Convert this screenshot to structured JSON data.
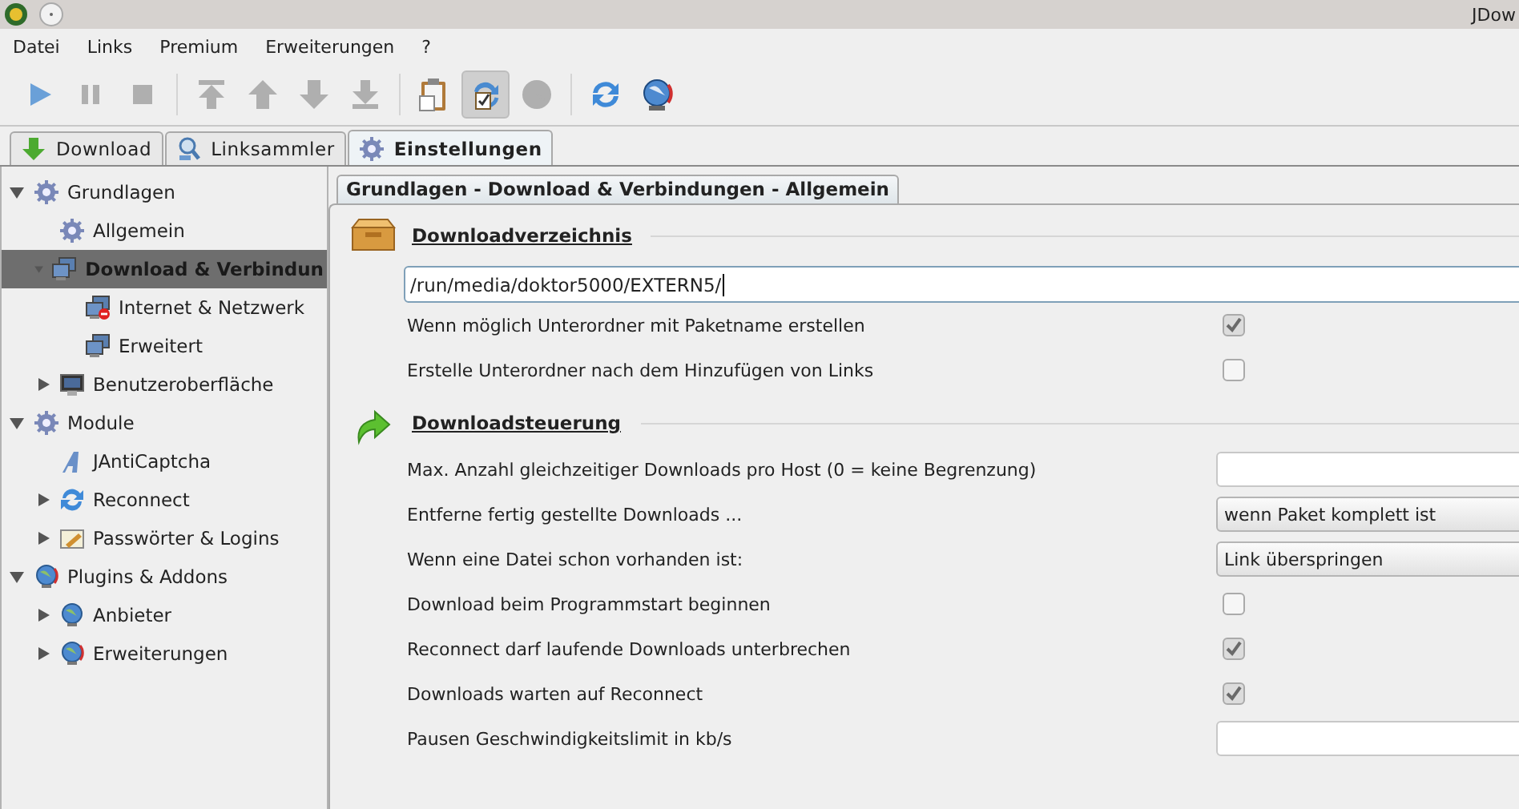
{
  "window": {
    "title": "JDow"
  },
  "menu": [
    "Datei",
    "Links",
    "Premium",
    "Erweiterungen",
    "?"
  ],
  "toolbar": [
    [
      {
        "disabled": false,
        "on": false
      },
      {
        "disabled": true,
        "on": false
      },
      {
        "disabled": true,
        "on": false
      }
    ],
    [
      {
        "disabled": true,
        "on": false
      },
      {
        "disabled": true,
        "on": false
      },
      {
        "disabled": true,
        "on": false
      },
      {
        "disabled": true,
        "on": false
      }
    ],
    [
      {
        "disabled": false,
        "on": false
      },
      {
        "disabled": false,
        "on": true
      },
      {
        "disabled": true,
        "on": false
      }
    ],
    [
      {
        "disabled": false,
        "on": false
      },
      {
        "disabled": false,
        "on": false
      }
    ]
  ],
  "tabs": [
    {
      "label": "Download",
      "selected": false
    },
    {
      "label": "Linksammler",
      "selected": false
    },
    {
      "label": "Einstellungen",
      "selected": true
    }
  ],
  "sidebar": {
    "items": [
      {
        "label": "Grundlagen",
        "selected": false,
        "expanded": true,
        "children": [
          {
            "label": "Allgemein",
            "selected": false
          },
          {
            "label": "Download & Verbindun",
            "selected": true,
            "expanded": true,
            "children": [
              {
                "label": "Internet & Netzwerk",
                "selected": false
              },
              {
                "label": "Erweitert",
                "selected": false
              }
            ]
          },
          {
            "label": "Benutzeroberfläche",
            "selected": false,
            "expanded": false
          }
        ]
      },
      {
        "label": "Module",
        "selected": false,
        "expanded": true,
        "children": [
          {
            "label": "JAntiCaptcha",
            "selected": false
          },
          {
            "label": "Reconnect",
            "selected": false,
            "expanded": false
          },
          {
            "label": "Passwörter & Logins",
            "selected": false,
            "expanded": false
          }
        ]
      },
      {
        "label": "Plugins & Addons",
        "selected": false,
        "expanded": true,
        "children": [
          {
            "label": "Anbieter",
            "selected": false,
            "expanded": false
          },
          {
            "label": "Erweiterungen",
            "selected": false,
            "expanded": false
          }
        ]
      }
    ]
  },
  "panel": {
    "tab": "Grundlagen - Download & Verbindungen - Allgemein",
    "sections": [
      {
        "title": "Downloadverzeichnis",
        "rows": [
          {
            "kind": "path",
            "value": "/run/media/doktor5000/EXTERN5/"
          },
          {
            "kind": "checkbox",
            "label": "Wenn möglich Unterordner mit Paketname erstellen",
            "checked": true
          },
          {
            "kind": "checkbox",
            "label": "Erstelle Unterordner nach dem Hinzufügen von Links",
            "checked": false
          }
        ]
      },
      {
        "title": "Downloadsteuerung",
        "rows": [
          {
            "kind": "number",
            "label": "Max. Anzahl gleichzeitiger Downloads pro Host (0 = keine Begrenzung)"
          },
          {
            "kind": "select",
            "label": "Entferne fertig gestellte Downloads ...",
            "value": "wenn Paket komplett ist"
          },
          {
            "kind": "select",
            "label": "Wenn eine Datei schon vorhanden ist:",
            "value": "Link überspringen"
          },
          {
            "kind": "checkbox",
            "label": "Download beim Programmstart beginnen",
            "checked": false
          },
          {
            "kind": "checkbox",
            "label": "Reconnect darf laufende Downloads unterbrechen",
            "checked": true
          },
          {
            "kind": "checkbox",
            "label": "Downloads warten auf Reconnect",
            "checked": true
          },
          {
            "kind": "number",
            "label": "Pausen Geschwindigkeitslimit in kb/s"
          }
        ]
      }
    ]
  }
}
